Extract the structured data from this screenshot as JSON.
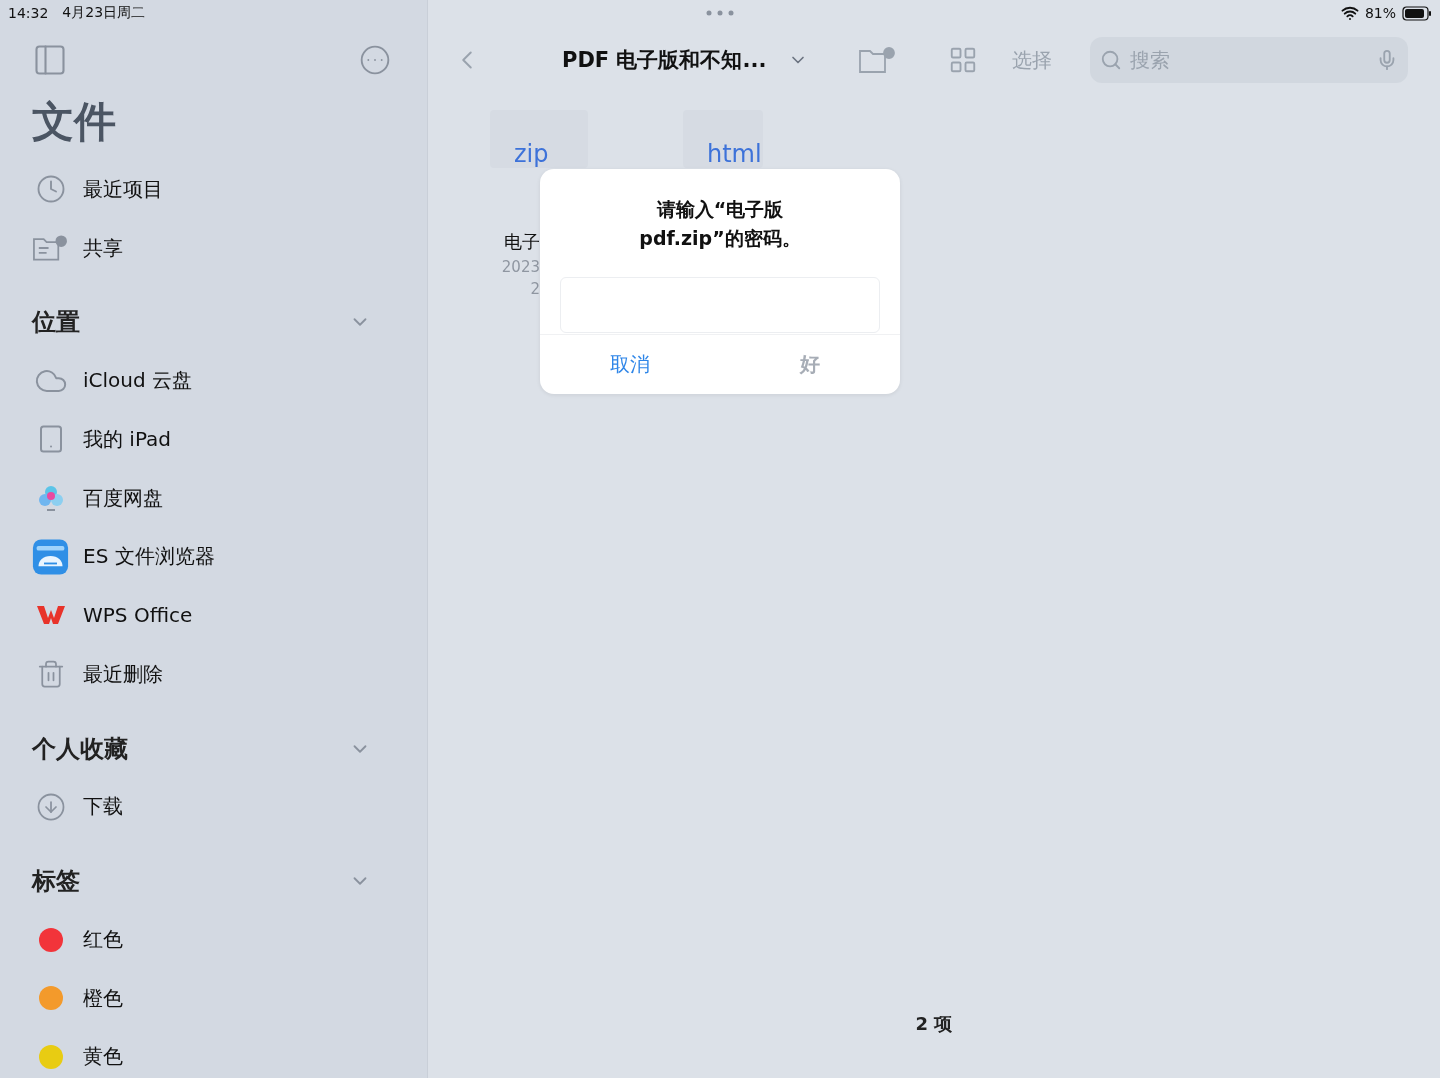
{
  "status_bar": {
    "time": "14:32",
    "date": "4月23日周二",
    "battery": "81%"
  },
  "sidebar": {
    "title": "文件",
    "top_items": [
      {
        "label": "最近项目",
        "kind": "clock"
      },
      {
        "label": "共享",
        "kind": "shared"
      }
    ],
    "sections": [
      {
        "title": "位置",
        "expanded": true,
        "items": [
          {
            "label": "iCloud 云盘",
            "kind": "cloud"
          },
          {
            "label": "我的 iPad",
            "kind": "ipad"
          },
          {
            "label": "百度网盘",
            "kind": "baidu"
          },
          {
            "label": "ES 文件浏览器",
            "kind": "es"
          },
          {
            "label": "WPS Office",
            "kind": "wps"
          },
          {
            "label": "最近删除",
            "kind": "trash"
          }
        ]
      },
      {
        "title": "个人收藏",
        "expanded": true,
        "items": [
          {
            "label": "下载",
            "kind": "download"
          }
        ]
      },
      {
        "title": "标签",
        "expanded": true,
        "items": [
          {
            "label": "红色",
            "kind": "tag",
            "color": "#f2343a"
          },
          {
            "label": "橙色",
            "kind": "tag",
            "color": "#f39a2b"
          },
          {
            "label": "黄色",
            "kind": "tag",
            "color": "#e8cc12"
          }
        ]
      }
    ]
  },
  "toolbar": {
    "title": "PDF 电子版和不知...",
    "select": "选择",
    "search": {
      "placeholder": "搜索"
    }
  },
  "files": [
    {
      "thumb": "zip",
      "name": "电子",
      "date": "2023",
      "size": "2"
    },
    {
      "thumb": "html"
    }
  ],
  "dialog": {
    "message": "请输入“电子版\npdf.zip”的密码。",
    "buttons": [
      {
        "label": "取消",
        "kind": "cancel",
        "disabled": false
      },
      {
        "label": "好",
        "kind": "ok",
        "disabled": true
      }
    ]
  },
  "footer": {
    "count": "2 项"
  }
}
